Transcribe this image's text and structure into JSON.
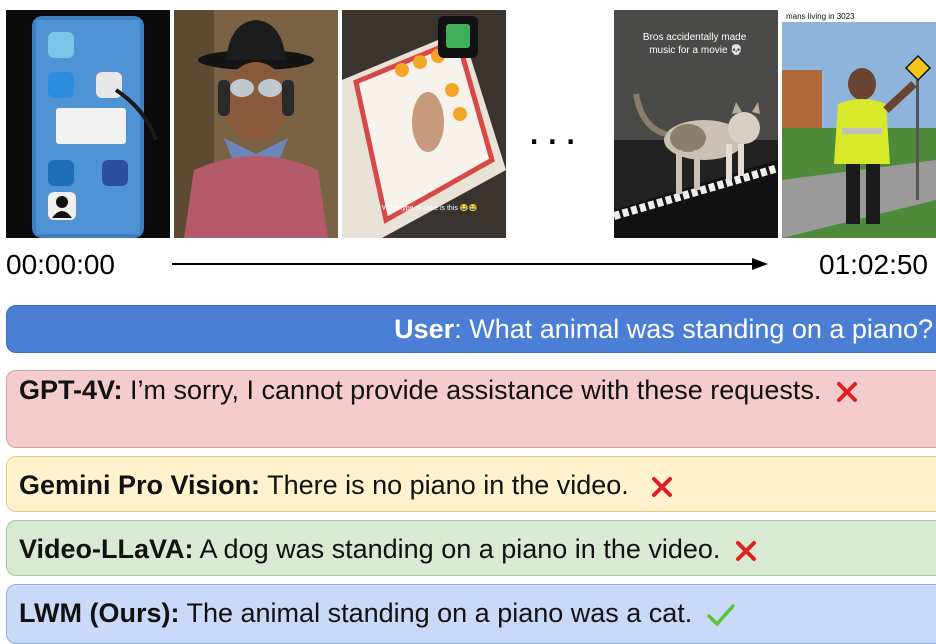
{
  "frames": [
    {
      "name": "phone-screen"
    },
    {
      "name": "man-in-hat",
      "caption": ""
    },
    {
      "name": "cake",
      "caption": "What type of cake is this 😂😂"
    },
    {
      "name": "cat-on-piano",
      "caption": "Bros accidentally made music for a movie 💀"
    },
    {
      "name": "man-with-slow-sign",
      "caption": "mans living in 3023"
    }
  ],
  "timeline": {
    "ellipsis": "...",
    "start": "00:00:00",
    "end": "01:02:50"
  },
  "user": {
    "speaker": "User",
    "question": ": What animal was standing on a piano?"
  },
  "answers": [
    {
      "model": "GPT-4V:",
      "text": " I’m sorry, I cannot provide assistance with these requests.",
      "correct": false
    },
    {
      "model": "Gemini Pro Vision:",
      "text": " There is no piano in the video.",
      "correct": false
    },
    {
      "model": "Video-LLaVA:",
      "text": " A dog was standing on a piano in the video.",
      "correct": false
    },
    {
      "model": "LWM (Ours):",
      "text": " The animal standing on a piano was a cat.",
      "correct": true
    }
  ],
  "colors": {
    "user_bubble": "#4a7fd5",
    "gpt_bubble": "#f4cccc",
    "gemini_bubble": "#fff2cc",
    "vllava_bubble": "#d9ead3",
    "lwm_bubble": "#c9daf8",
    "wrong_mark": "#e02020",
    "right_mark": "#5cc23a"
  }
}
